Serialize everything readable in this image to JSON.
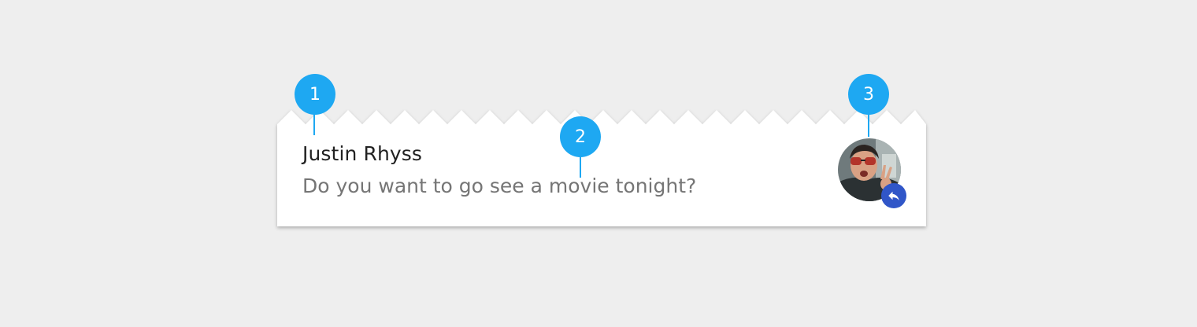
{
  "notification": {
    "title": "Justin Rhyss",
    "message": "Do you want to go see a movie tonight?",
    "avatar_icon": "user-photo-avatar",
    "badge_icon": "reply-icon"
  },
  "callouts": [
    {
      "label": "1"
    },
    {
      "label": "2"
    },
    {
      "label": "3"
    }
  ],
  "colors": {
    "background": "#eeeeee",
    "card": "#ffffff",
    "title_text": "#212121",
    "message_text": "#757575",
    "callout": "#1ea8f2",
    "reply_badge": "#3056c8"
  }
}
